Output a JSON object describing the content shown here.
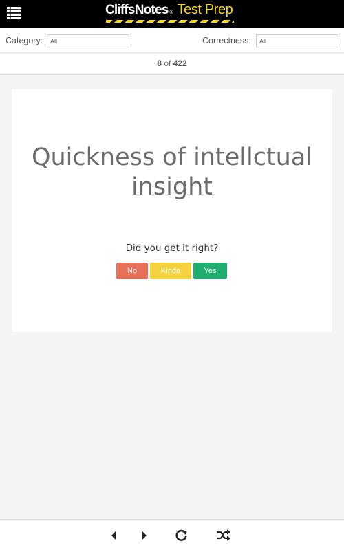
{
  "header": {
    "brand_primary": "CliffsNotes",
    "brand_registered": "®",
    "brand_secondary": "Test Prep",
    "icon_menu": "list-menu-icon",
    "colors": {
      "background": "#000000",
      "accent": "#f7d90a"
    }
  },
  "filters": {
    "category_label": "Category:",
    "category_value": "All",
    "correctness_label": "Correctness:",
    "correctness_value": "All"
  },
  "counter": {
    "current": "8",
    "separator": "of",
    "total": "422"
  },
  "card": {
    "term": "Quickness of intellctual insight",
    "question": "Did you get it right?",
    "buttons": {
      "no": "No",
      "kinda": "Kinda",
      "yes": "Yes"
    },
    "colors": {
      "no": "#e8715a",
      "kinda": "#f5d33e",
      "yes": "#1fae6e"
    }
  },
  "footer": {
    "icons": [
      "previous-arrow-icon",
      "next-arrow-icon",
      "refresh-icon",
      "shuffle-icon"
    ]
  }
}
